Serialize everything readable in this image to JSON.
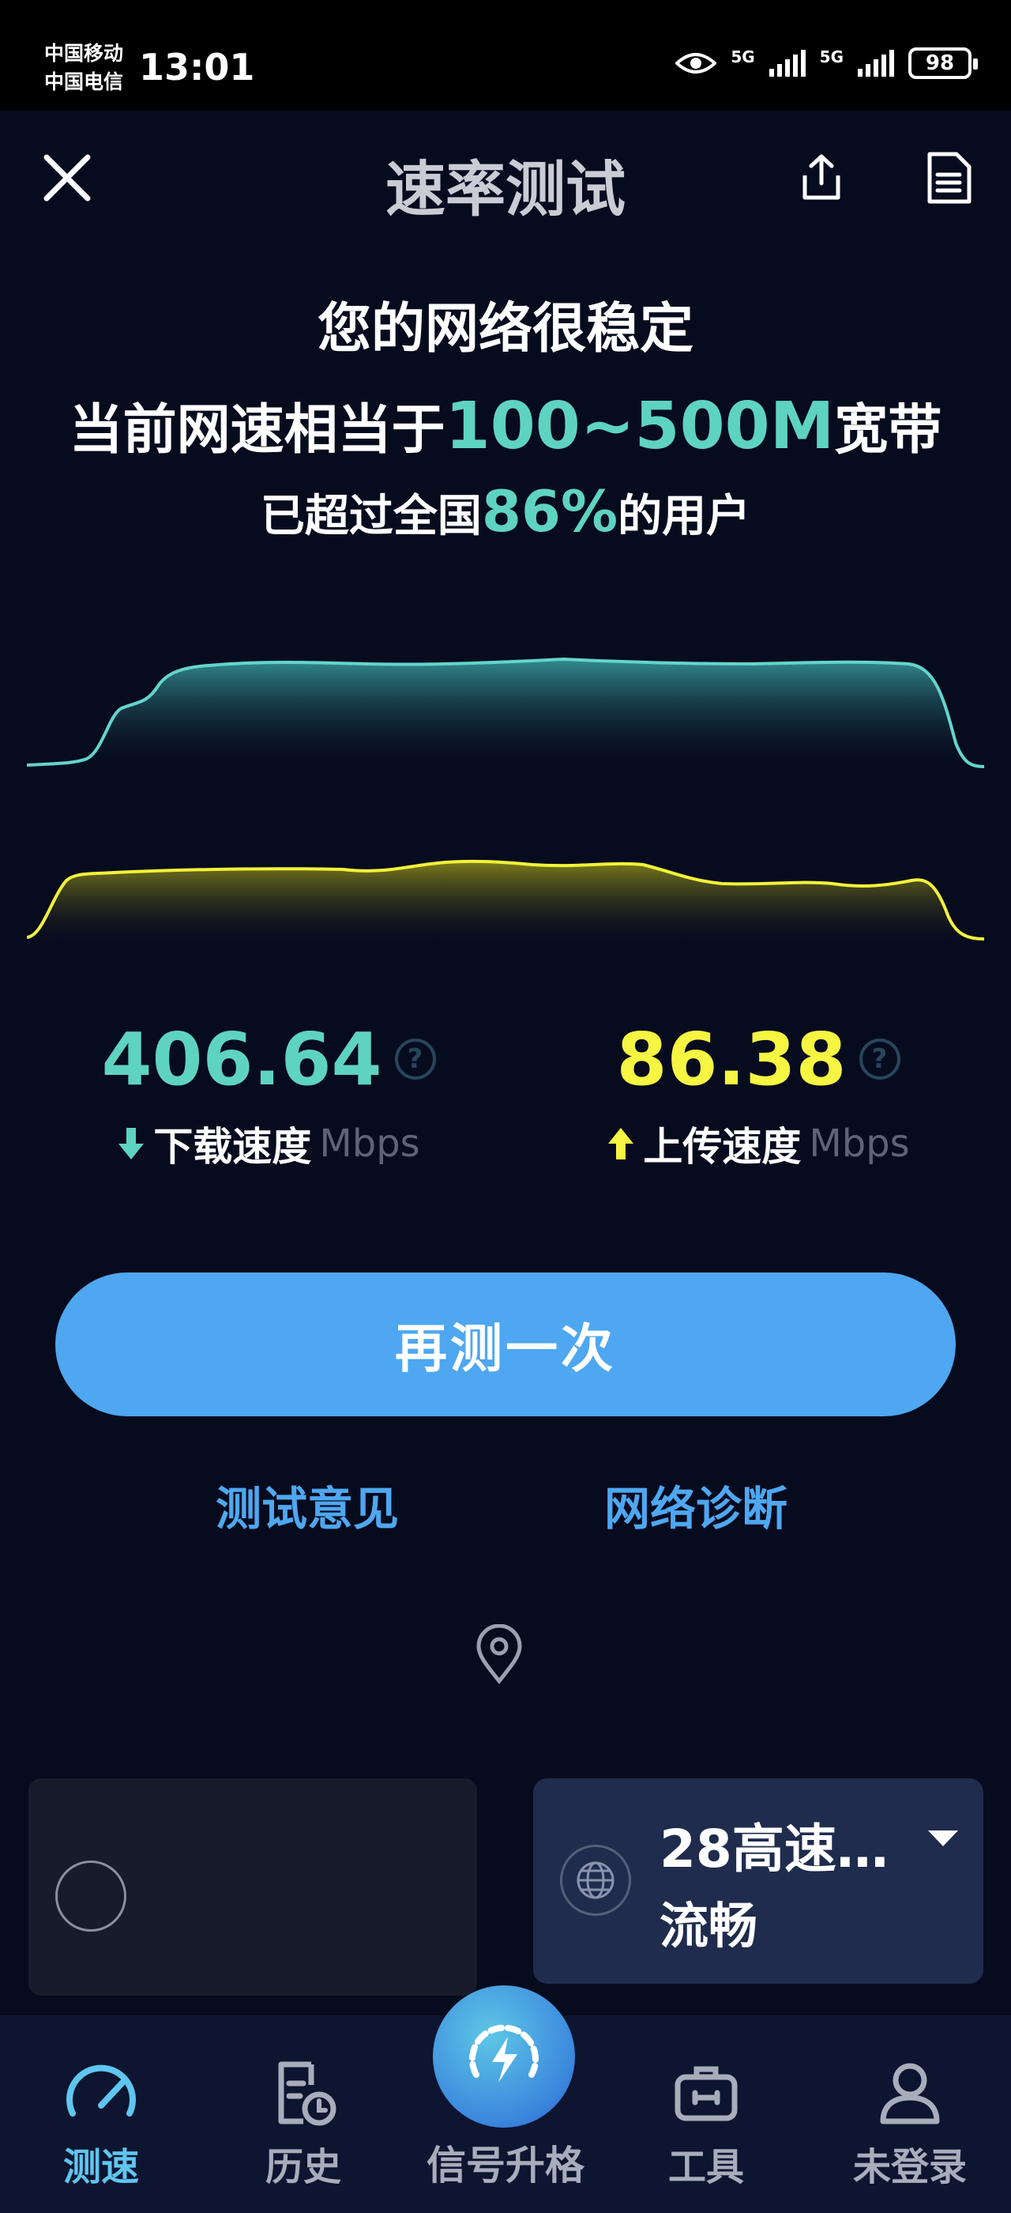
{
  "status_bar": {
    "carrier1": "中国移动",
    "carrier2": "中国电信",
    "time": "13:01",
    "net1": "5G",
    "net2": "5G",
    "battery": "98"
  },
  "header": {
    "title": "速率测试"
  },
  "summary": {
    "line1": "您的网络很稳定",
    "line2_prefix": "当前网速相当于",
    "line2_value": "100~500M",
    "line2_suffix": "宽带",
    "line3_prefix": "已超过全国",
    "line3_value": "86%",
    "line3_suffix": "的用户"
  },
  "download": {
    "value": "406.64",
    "label": "下载速度",
    "unit": "Mbps",
    "help": "?",
    "color": "#5fd3c2"
  },
  "upload": {
    "value": "86.38",
    "label": "上传速度",
    "unit": "Mbps",
    "help": "?",
    "color": "#f5f542"
  },
  "actions": {
    "retest": "再测一次",
    "feedback": "测试意见",
    "diagnose": "网络诊断"
  },
  "node_card": {
    "name": "28高速…",
    "status": "流畅"
  },
  "nav": {
    "items": [
      {
        "label": "测速",
        "icon": "speedometer-icon",
        "active": true
      },
      {
        "label": "历史",
        "icon": "history-icon"
      },
      {
        "label": "信号升格",
        "icon": "boost-icon"
      },
      {
        "label": "工具",
        "icon": "toolbox-icon"
      },
      {
        "label": "未登录",
        "icon": "user-icon"
      }
    ]
  },
  "colors": {
    "accent": "#5fd3c2",
    "upload": "#f5f542",
    "button": "#4ea7f0",
    "background": "#070b1e"
  }
}
